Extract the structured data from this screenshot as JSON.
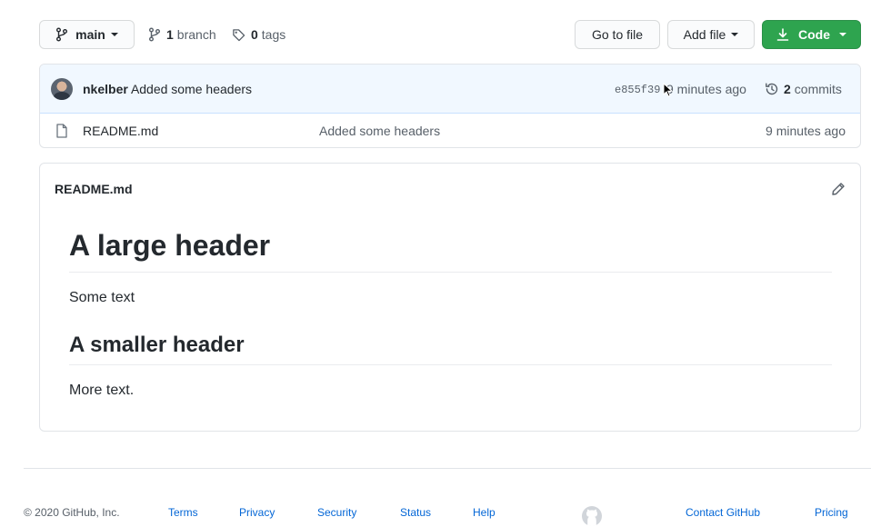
{
  "toolbar": {
    "branch_select": "main",
    "branch_count": "1",
    "branch_label": "branch",
    "tag_count": "0",
    "tag_label": "tags",
    "go_to_file": "Go to file",
    "add_file": "Add file",
    "code": "Code"
  },
  "commit": {
    "author": "nkelber",
    "message": "Added some headers",
    "sha": "e855f39",
    "time": "9 minutes ago",
    "commit_count": "2",
    "commit_label": "commits"
  },
  "files": [
    {
      "name": "README.md",
      "message": "Added some headers",
      "time": "9 minutes ago"
    }
  ],
  "readme": {
    "filename": "README.md",
    "h1": "A large header",
    "p1": "Some text",
    "h2": "A smaller header",
    "p2": "More text."
  },
  "footer": {
    "copyright": "© 2020 GitHub, Inc.",
    "links": [
      "Terms",
      "Privacy",
      "Security",
      "Status",
      "Help"
    ],
    "right_links": [
      "Contact GitHub",
      "Pricing"
    ]
  },
  "icons": {
    "branch": "git-branch-icon",
    "tag": "tag-icon",
    "download": "download-icon",
    "history": "history-icon",
    "file": "file-icon",
    "edit": "pencil-icon",
    "logo": "github-mark-icon",
    "cursor": "mouse-cursor-icon"
  },
  "colors": {
    "accent_green": "#2ea44f",
    "link_blue": "#0366d6",
    "commit_row_bg": "#f1f8ff"
  }
}
